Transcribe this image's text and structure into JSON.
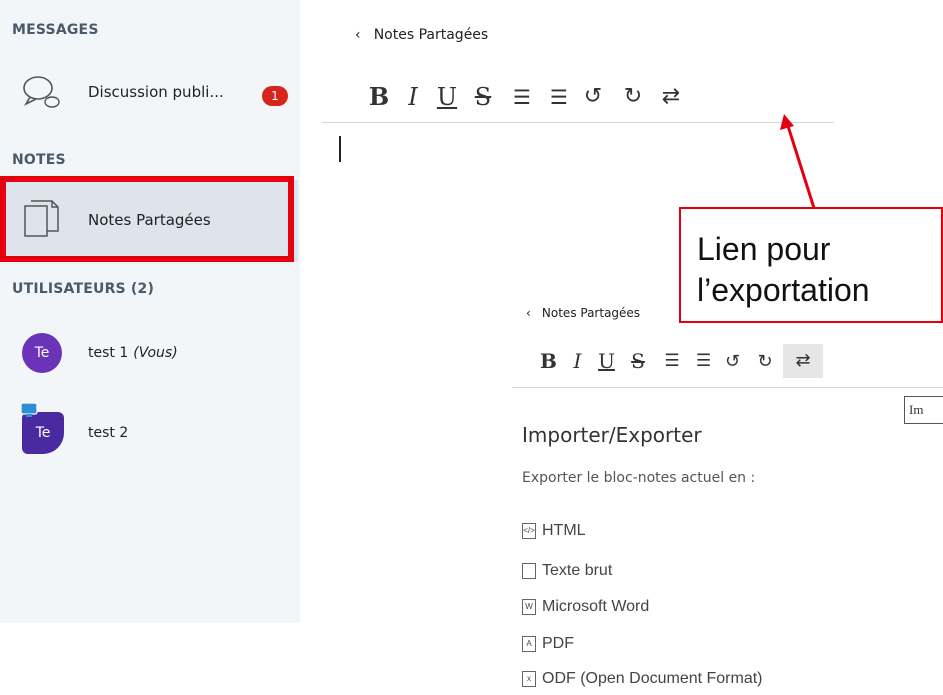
{
  "sidebar": {
    "messages_title": "MESSAGES",
    "public_chat": {
      "label": "Discussion publi...",
      "badge": "1",
      "icon": "chat-bubbles-icon"
    },
    "notes_title": "NOTES",
    "shared_notes": {
      "label": "Notes Partagées",
      "icon": "documents-icon"
    },
    "users_title": "UTILISATEURS (2)",
    "users": [
      {
        "initials": "Te",
        "name": "test 1",
        "you": "(Vous)"
      },
      {
        "initials": "Te",
        "name": "test 2"
      }
    ]
  },
  "editor": {
    "back_label": "Notes Partagées",
    "toolbar": {
      "bold": "B",
      "italic": "I",
      "underline": "U",
      "strike": "S",
      "ordered": "☰",
      "unordered": "☰",
      "undo": "↺",
      "redo": "↻",
      "export": "⇄"
    }
  },
  "callout": {
    "line1": "Lien pour",
    "line2": "l’exportation"
  },
  "export_panel": {
    "back_label": "Notes Partagées",
    "tooltip": "Im",
    "title": "Importer/Exporter",
    "subtitle": "Exporter le bloc-notes actuel en :",
    "formats": [
      {
        "label": "HTML",
        "icon": "html-file-icon"
      },
      {
        "label": "Texte brut",
        "icon": "text-file-icon"
      },
      {
        "label": "Microsoft Word",
        "icon": "word-file-icon"
      },
      {
        "label": "PDF",
        "icon": "pdf-file-icon"
      },
      {
        "label": "ODF (Open Document Format)",
        "icon": "odf-file-icon"
      }
    ]
  },
  "colors": {
    "accent_red": "#e4000f",
    "badge": "#d8251b",
    "avatar": "#6b33b8",
    "sidebar_bg": "#f3f6f9"
  }
}
